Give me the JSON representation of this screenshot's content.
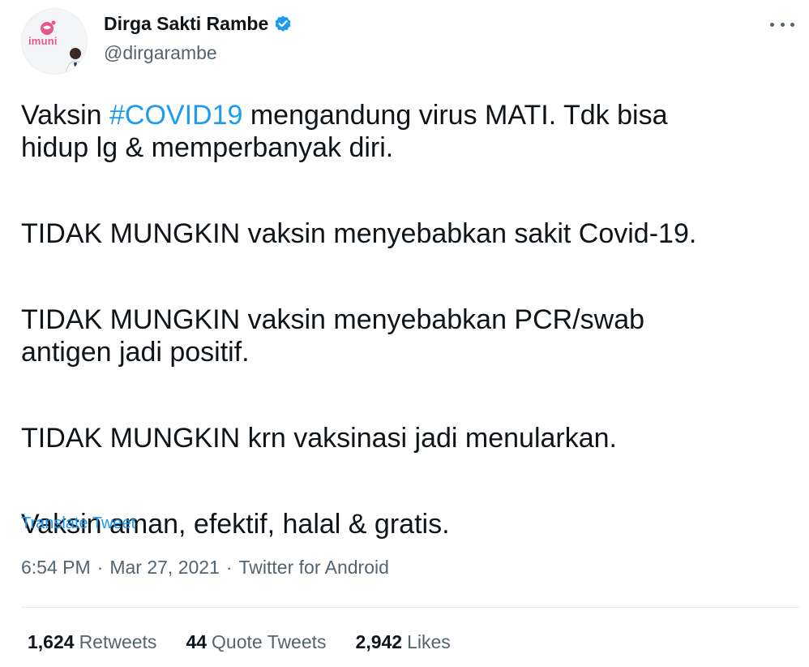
{
  "author": {
    "display_name": "Dirga Sakti Rambe",
    "handle": "@dirgarambe",
    "avatar_logo_text": "imuni",
    "verified_icon": "verified-badge-icon",
    "avatar_icon": "avatar-image"
  },
  "more_icon": "more-options-icon",
  "tweet": {
    "line1_before": "Vaksin ",
    "hashtag": "#COVID19",
    "line1_after": " mengandung virus MATI. Tdk bisa",
    "line2": "hidup lg & memperbanyak diri.",
    "para2": "TIDAK MUNGKIN vaksin menyebabkan sakit Covid-19.",
    "para3_line1": "TIDAK MUNGKIN vaksin menyebabkan PCR/swab",
    "para3_line2": "antigen jadi positif.",
    "para4": "TIDAK MUNGKIN krn vaksinasi jadi menularkan.",
    "para5": "Vaksin aman, efektif, halal & gratis."
  },
  "translate_label": "Translate Tweet",
  "meta": {
    "time": "6:54 PM",
    "separator": "·",
    "date": "Mar 27, 2021",
    "source": "Twitter for Android"
  },
  "stats": {
    "retweets_count": "1,624",
    "retweets_label": "Retweets",
    "quotes_count": "44",
    "quotes_label": "Quote Tweets",
    "likes_count": "2,942",
    "likes_label": "Likes"
  },
  "colors": {
    "link": "#1d9bf0",
    "secondary_text": "#536471",
    "primary_text": "#0f1419",
    "brand_pink": "#e8568c"
  }
}
